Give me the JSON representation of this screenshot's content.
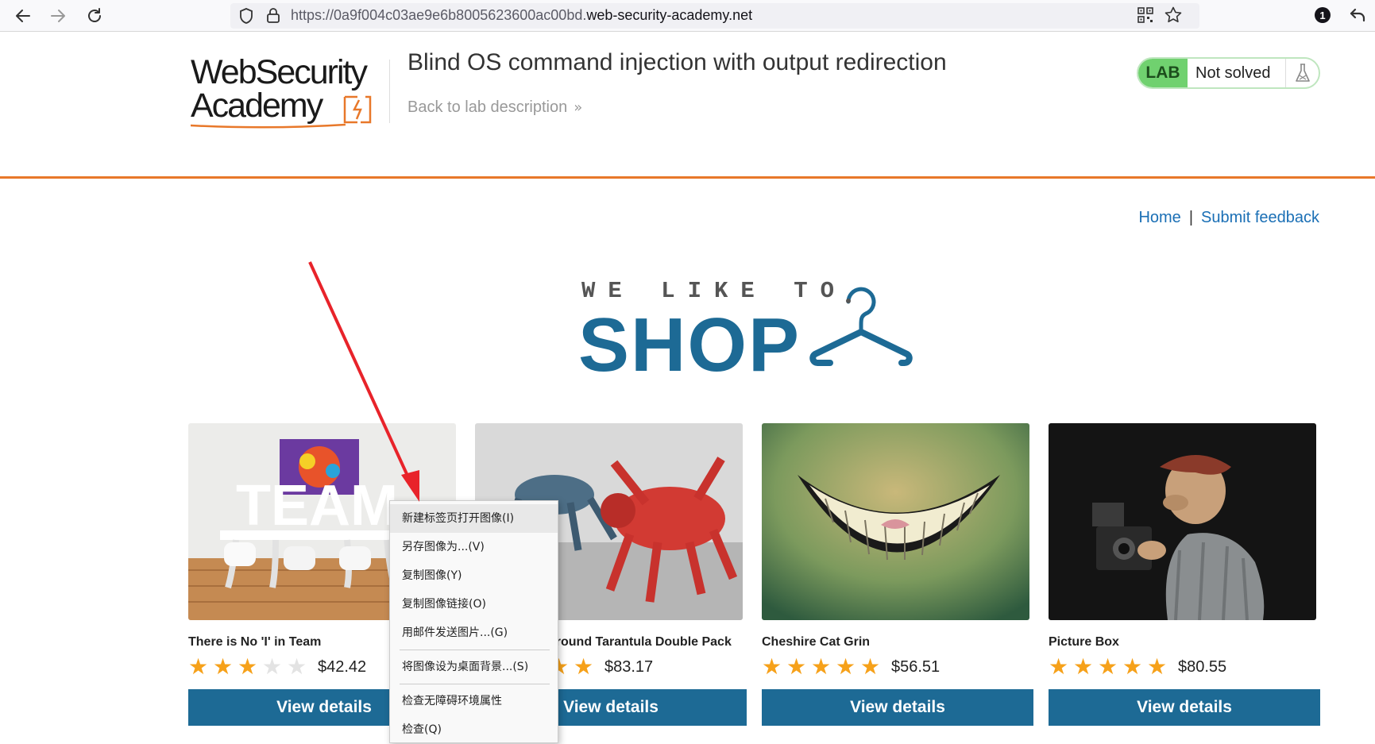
{
  "browser": {
    "url_prefix": "https://0a9f004c03ae9e6b8005623600ac00bd.",
    "url_domain": "web-security-academy.net",
    "notification_count": "1",
    "icons": [
      "back-icon",
      "forward-icon",
      "reload-icon",
      "shield-icon",
      "lock-icon",
      "qr-code-icon",
      "bookmark-star-icon",
      "notification-badge-icon",
      "undo-arrow-icon"
    ]
  },
  "header": {
    "logo_line1": "WebSecurity",
    "logo_line2": "Academy",
    "lab_title": "Blind OS command injection with output redirection",
    "back_link": "Back to lab description",
    "lab_badge": "LAB",
    "lab_status": "Not solved"
  },
  "nav": {
    "home": "Home",
    "separator": "|",
    "feedback": "Submit feedback"
  },
  "banner": {
    "small": "WE LIKE TO",
    "big": "SHOP"
  },
  "products": [
    {
      "name": "There is No 'I' in Team",
      "rating": 3,
      "price": "$42.42",
      "button": "View details"
    },
    {
      "name": "Giant Underground Tarantula Double Pack",
      "visible_name": "ground Tarantula Double Pack",
      "rating": 5,
      "price": "$83.17",
      "button": "View details"
    },
    {
      "name": "Cheshire Cat Grin",
      "rating": 5,
      "price": "$56.51",
      "button": "View details"
    },
    {
      "name": "Picture Box",
      "rating": 5,
      "price": "$80.55",
      "button": "View details"
    }
  ],
  "context_menu": {
    "items": [
      "新建标签页打开图像(I)",
      "另存图像为...(V)",
      "复制图像(Y)",
      "复制图像链接(O)",
      "用邮件发送图片...(G)",
      "将图像设为桌面背景...(S)",
      "检查无障碍环境属性",
      "检查(Q)"
    ]
  },
  "colors": {
    "accent_orange": "#e8782a",
    "brand_blue": "#1d6a95",
    "link_blue": "#1a6fb5",
    "star_gold": "#f6a11a",
    "lab_green": "#70d16f",
    "annotation_red": "#e8232a"
  }
}
